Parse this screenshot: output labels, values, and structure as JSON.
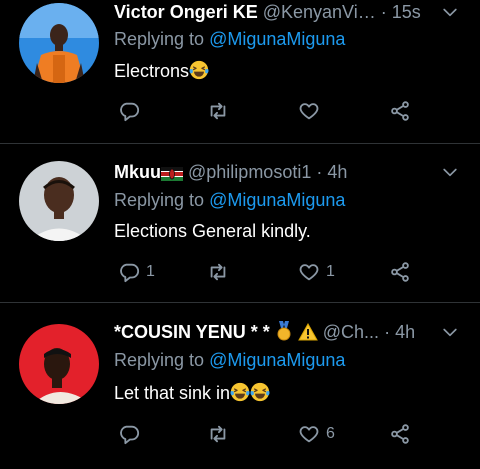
{
  "tweets": [
    {
      "name": "Victor Ongeri KE",
      "handle": "@KenyanVi…",
      "sep": "·",
      "time": "15s",
      "replying_prefix": "Replying to ",
      "replying_to": "@MigunaMiguna",
      "text": "Electrons",
      "text_emojis": [
        "laughing-tears-emoji"
      ],
      "actions": {
        "reply_count": "",
        "retweet_count": "",
        "like_count": ""
      }
    },
    {
      "name": "Mkuu",
      "name_flag": "kenya-flag",
      "handle": "@philipmosoti1",
      "sep": "·",
      "time": "4h",
      "replying_prefix": "Replying to ",
      "replying_to": "@MigunaMiguna",
      "text": "Elections General kindly.",
      "actions": {
        "reply_count": "1",
        "retweet_count": "",
        "like_count": "1"
      }
    },
    {
      "name": "*COUSIN YENU * *",
      "name_badges": [
        "medal-emoji",
        "warning-emoji"
      ],
      "handle": "@Ch...",
      "sep": "·",
      "time": "4h",
      "replying_prefix": "Replying to ",
      "replying_to": "@MigunaMiguna",
      "text": "Let that sink in",
      "text_emojis": [
        "laughing-tears-emoji",
        "laughing-tears-emoji"
      ],
      "actions": {
        "reply_count": "",
        "retweet_count": "",
        "like_count": "6"
      }
    }
  ],
  "colors": {
    "background": "#000000",
    "muted": "#8b98a5",
    "link": "#1d9bf0",
    "divider": "#2f3336"
  }
}
